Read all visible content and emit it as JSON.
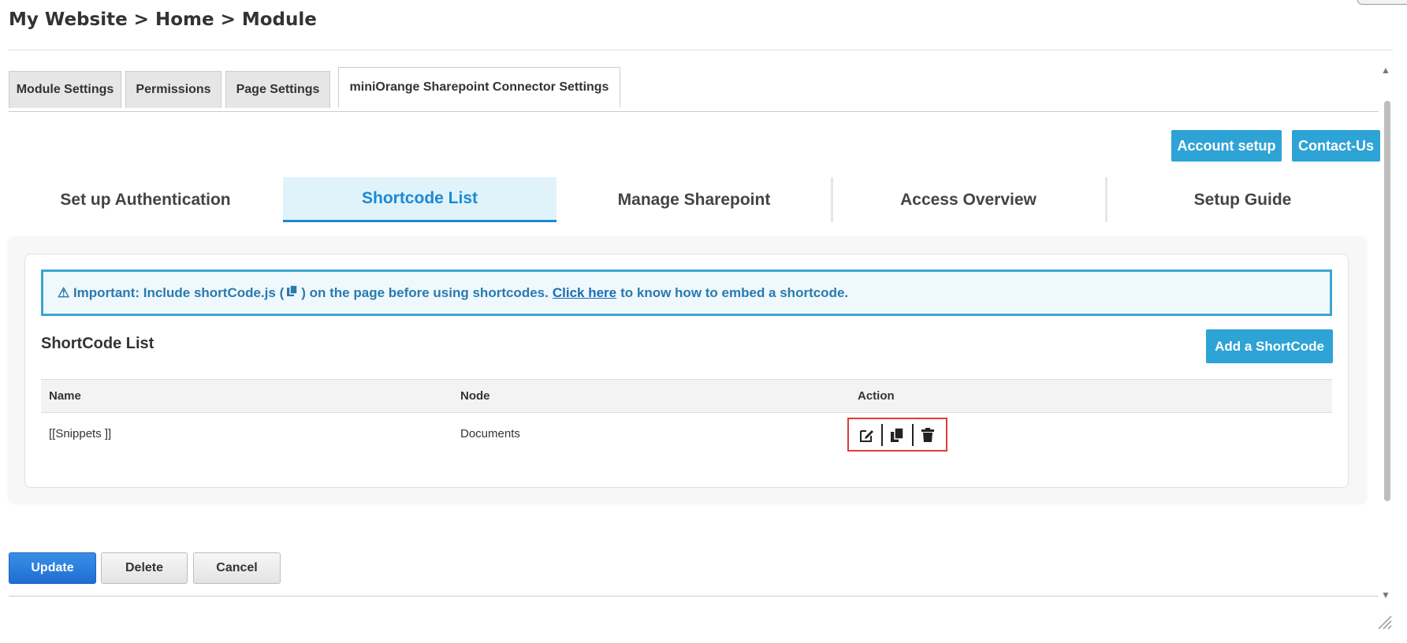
{
  "breadcrumb": "My Website > Home > Module",
  "module_tabs": [
    {
      "label": "Module Settings"
    },
    {
      "label": "Permissions"
    },
    {
      "label": "Page Settings"
    },
    {
      "label": "miniOrange Sharepoint Connector Settings",
      "active": true
    }
  ],
  "header_buttons": {
    "account_setup": "Account setup",
    "contact_us": "Contact-Us"
  },
  "inner_tabs": [
    {
      "label": "Set up Authentication"
    },
    {
      "label": "Shortcode List",
      "active": true
    },
    {
      "label": "Manage Sharepoint"
    },
    {
      "label": "Access Overview"
    },
    {
      "label": "Setup Guide"
    }
  ],
  "notice": {
    "prefix": "⚠ Important: Include shortCode.js (",
    "middle": ") on the page before using shortcodes.",
    "link": "Click here",
    "suffix": "to know how to embed a shortcode."
  },
  "list": {
    "title": "ShortCode List",
    "add_button": "Add a ShortCode",
    "columns": [
      "Name",
      "Node",
      "Action"
    ],
    "rows": [
      {
        "name": "[[Snippets ]]",
        "node": "Documents",
        "actions": [
          "edit-icon",
          "copy-icon",
          "trash-icon"
        ]
      }
    ]
  },
  "footer_buttons": {
    "update": "Update",
    "delete": "Delete",
    "cancel": "Cancel"
  },
  "colors": {
    "accent": "#2ea3d6",
    "active_tab_text": "#1a8ad4",
    "highlight_box": "#e03b3b",
    "update_button": "#1f6ed4"
  }
}
